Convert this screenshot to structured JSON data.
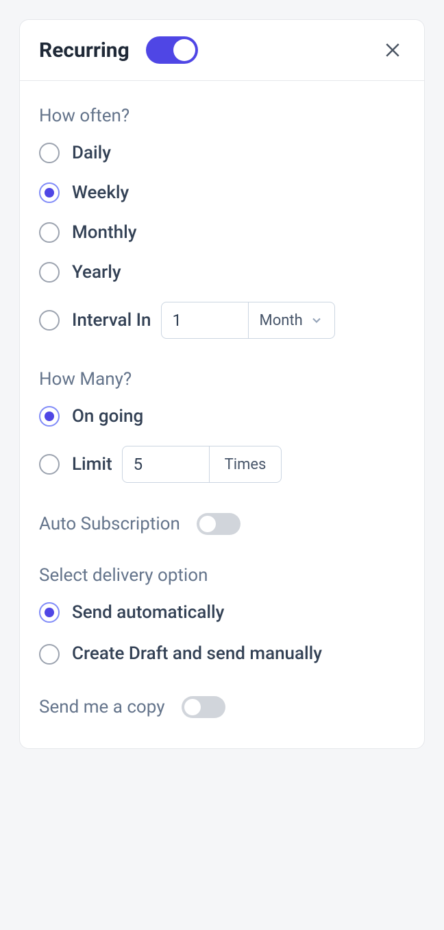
{
  "header": {
    "title": "Recurring",
    "toggle_on": true
  },
  "how_often": {
    "label": "How often?",
    "options": {
      "daily": "Daily",
      "weekly": "Weekly",
      "monthly": "Monthly",
      "yearly": "Yearly",
      "interval": "Interval In"
    },
    "selected": "weekly",
    "interval_value": "1",
    "interval_unit": "Month"
  },
  "how_many": {
    "label": "How Many?",
    "options": {
      "ongoing": "On going",
      "limit": "Limit"
    },
    "selected": "ongoing",
    "limit_value": "5",
    "limit_unit": "Times"
  },
  "auto_subscription": {
    "label": "Auto Subscription",
    "on": false
  },
  "delivery": {
    "label": "Select delivery option",
    "options": {
      "auto": "Send automatically",
      "draft": "Create Draft and send manually"
    },
    "selected": "auto"
  },
  "send_copy": {
    "label": "Send me a copy",
    "on": false
  }
}
